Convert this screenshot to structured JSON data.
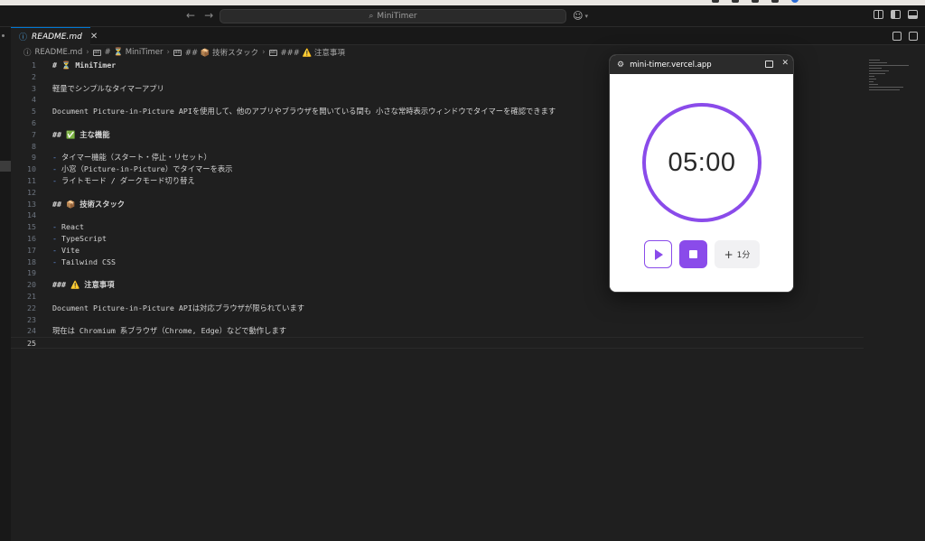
{
  "titlebar": {
    "nav_back": "←",
    "nav_forward": "→",
    "search_text": "MiniTimer",
    "search_icon": "⌕"
  },
  "tab": {
    "label": "README.md",
    "info_icon": "ⓘ",
    "close_icon": "✕"
  },
  "breadcrumb": {
    "file": "README.md",
    "items": [
      "# ⏳ MiniTimer",
      "## 📦 技術スタック",
      "### ⚠️ 注意事項"
    ],
    "sep": "›"
  },
  "editor": {
    "lines": [
      {
        "n": "1",
        "text": "# ⏳ MiniTimer",
        "kind": "h"
      },
      {
        "n": "2",
        "text": "",
        "kind": "p"
      },
      {
        "n": "3",
        "text": "軽量でシンプルなタイマーアプリ",
        "kind": "p"
      },
      {
        "n": "4",
        "text": "",
        "kind": "p"
      },
      {
        "n": "5",
        "text": "Document Picture-in-Picture APIを使用して、他のアプリやブラウザを開いている間も 小さな常時表示ウィンドウでタイマーを確認できます",
        "kind": "p"
      },
      {
        "n": "6",
        "text": "",
        "kind": "p"
      },
      {
        "n": "7",
        "text": "## ✅ 主な機能",
        "kind": "h"
      },
      {
        "n": "8",
        "text": "",
        "kind": "p"
      },
      {
        "n": "9",
        "text": "- タイマー機能（スタート・停止・リセット）",
        "kind": "li"
      },
      {
        "n": "10",
        "text": "- 小窓（Picture-in-Picture）でタイマーを表示",
        "kind": "li"
      },
      {
        "n": "11",
        "text": "- ライトモード / ダークモード切り替え",
        "kind": "li"
      },
      {
        "n": "12",
        "text": "",
        "kind": "p"
      },
      {
        "n": "13",
        "text": "## 📦 技術スタック",
        "kind": "h"
      },
      {
        "n": "14",
        "text": "",
        "kind": "p"
      },
      {
        "n": "15",
        "text": "- React",
        "kind": "li"
      },
      {
        "n": "16",
        "text": "- TypeScript",
        "kind": "li"
      },
      {
        "n": "17",
        "text": "- Vite",
        "kind": "li"
      },
      {
        "n": "18",
        "text": "- Tailwind CSS",
        "kind": "li"
      },
      {
        "n": "19",
        "text": "",
        "kind": "p"
      },
      {
        "n": "20",
        "text": "### ⚠️ 注意事項",
        "kind": "h"
      },
      {
        "n": "21",
        "text": "",
        "kind": "p"
      },
      {
        "n": "22",
        "text": "Document Picture-in-Picture APIは対応ブラウザが限られています",
        "kind": "p"
      },
      {
        "n": "23",
        "text": "",
        "kind": "p"
      },
      {
        "n": "24",
        "text": "現在は Chromium 系ブラウザ（Chrome, Edge）などで動作します",
        "kind": "p"
      },
      {
        "n": "25",
        "text": "",
        "kind": "p"
      }
    ],
    "current_line": "25"
  },
  "pip": {
    "title": "mini-timer.vercel.app",
    "settings_icon": "⚙",
    "back_to_tab_icon": "back-to-tab-icon",
    "close_icon": "✕",
    "time": "05:00",
    "add_label": "1分",
    "add_plus": "+",
    "accent_color": "#8a4bea"
  }
}
